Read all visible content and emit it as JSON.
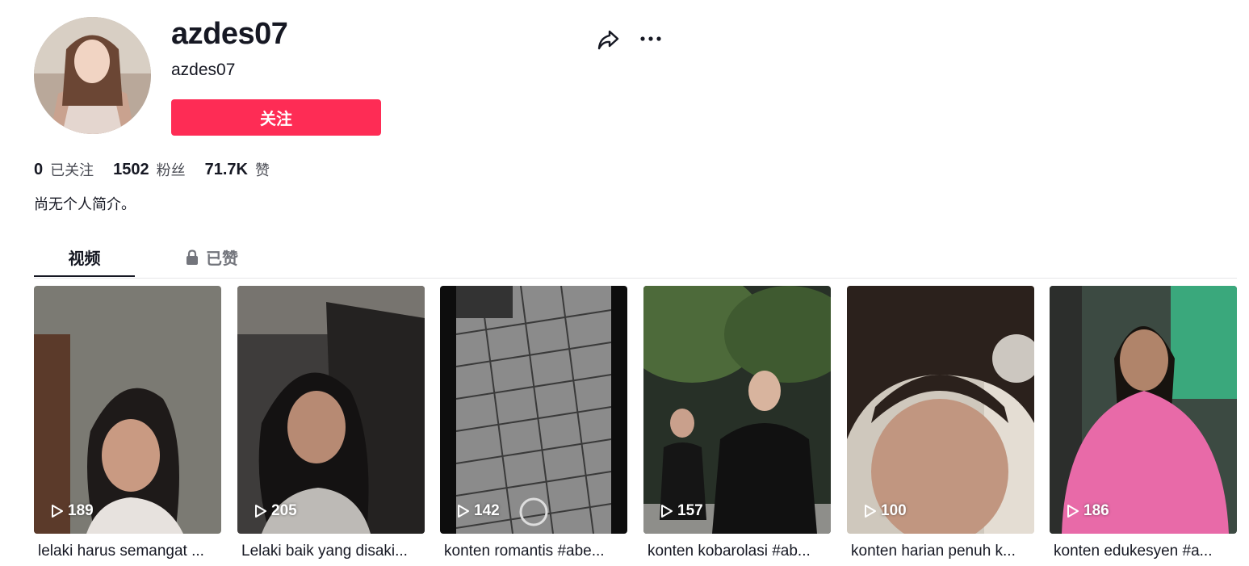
{
  "profile": {
    "title": "azdes07",
    "subtitle": "azdes07",
    "follow_label": "关注",
    "bio": "尚无个人简介。",
    "avatar_icon": "avatar-photo"
  },
  "header_actions": {
    "share_icon": "share-arrow-icon",
    "more_icon": "more-dots-icon"
  },
  "stats": [
    {
      "value": "0",
      "label": "已关注"
    },
    {
      "value": "1502",
      "label": "粉丝"
    },
    {
      "value": "71.7K",
      "label": "赞"
    }
  ],
  "tabs": [
    {
      "label": "视频",
      "active": true
    },
    {
      "label": "已赞",
      "active": false,
      "icon": "lock-icon"
    }
  ],
  "colors": {
    "accent": "#fe2c55",
    "text": "#161823",
    "muted": "#73757c"
  },
  "videos": [
    {
      "views": "189",
      "caption": "lelaki harus semangat ..."
    },
    {
      "views": "205",
      "caption": "Lelaki baik yang disaki..."
    },
    {
      "views": "142",
      "caption": "konten romantis #abe..."
    },
    {
      "views": "157",
      "caption": "konten kobarolasi #ab..."
    },
    {
      "views": "100",
      "caption": "konten harian penuh k..."
    },
    {
      "views": "186",
      "caption": "konten edukesyen #a..."
    }
  ]
}
